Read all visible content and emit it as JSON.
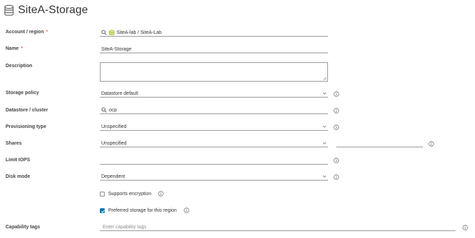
{
  "header": {
    "title": "SiteA-Storage",
    "icon": "database-icon"
  },
  "form": {
    "account_region": {
      "label": "Account / region",
      "value": "SiteA-lab / SiteA-Lab"
    },
    "name": {
      "label": "Name",
      "value": "SiteA-Storage"
    },
    "description": {
      "label": "Description",
      "value": ""
    },
    "storage_policy": {
      "label": "Storage policy",
      "value": "Datastore default"
    },
    "datastore": {
      "label": "Datastore / cluster",
      "value": "ocp"
    },
    "provisioning": {
      "label": "Provisioning type",
      "value": "Unspecified"
    },
    "shares": {
      "label": "Shares",
      "value": "Unspecified",
      "extra_value": ""
    },
    "limit_iops": {
      "label": "Limit IOPS",
      "value": ""
    },
    "disk_mode": {
      "label": "Disk mode",
      "value": "Dependent"
    },
    "supports_encryption": {
      "label": "Supports encryption",
      "checked": false
    },
    "preferred_storage": {
      "label": "Preferred storage for this region",
      "checked": true
    },
    "capability_tags": {
      "label": "Capability tags",
      "placeholder": "Enter capability tags"
    }
  },
  "colors": {
    "accent": "#0079b8",
    "required": "#c92100",
    "folder": "#9bc93c"
  }
}
